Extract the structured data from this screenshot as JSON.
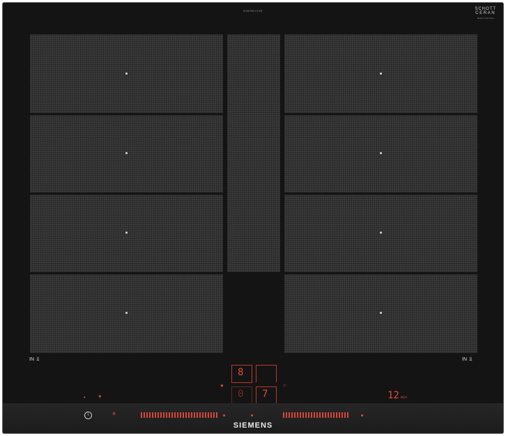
{
  "model_number": "EX675LYV1E",
  "brand_schott": {
    "line1": "SCHOTT",
    "line2": "CERAN",
    "line3": "Made in Germany"
  },
  "zone_labels": {
    "left": "IN",
    "right": "IN"
  },
  "controls": {
    "timer_top_digit": "8",
    "left_display_digit": "0",
    "right_display_digit": "7",
    "timer_value": "12",
    "timer_unit": "min"
  },
  "brand": "SIEMENS"
}
